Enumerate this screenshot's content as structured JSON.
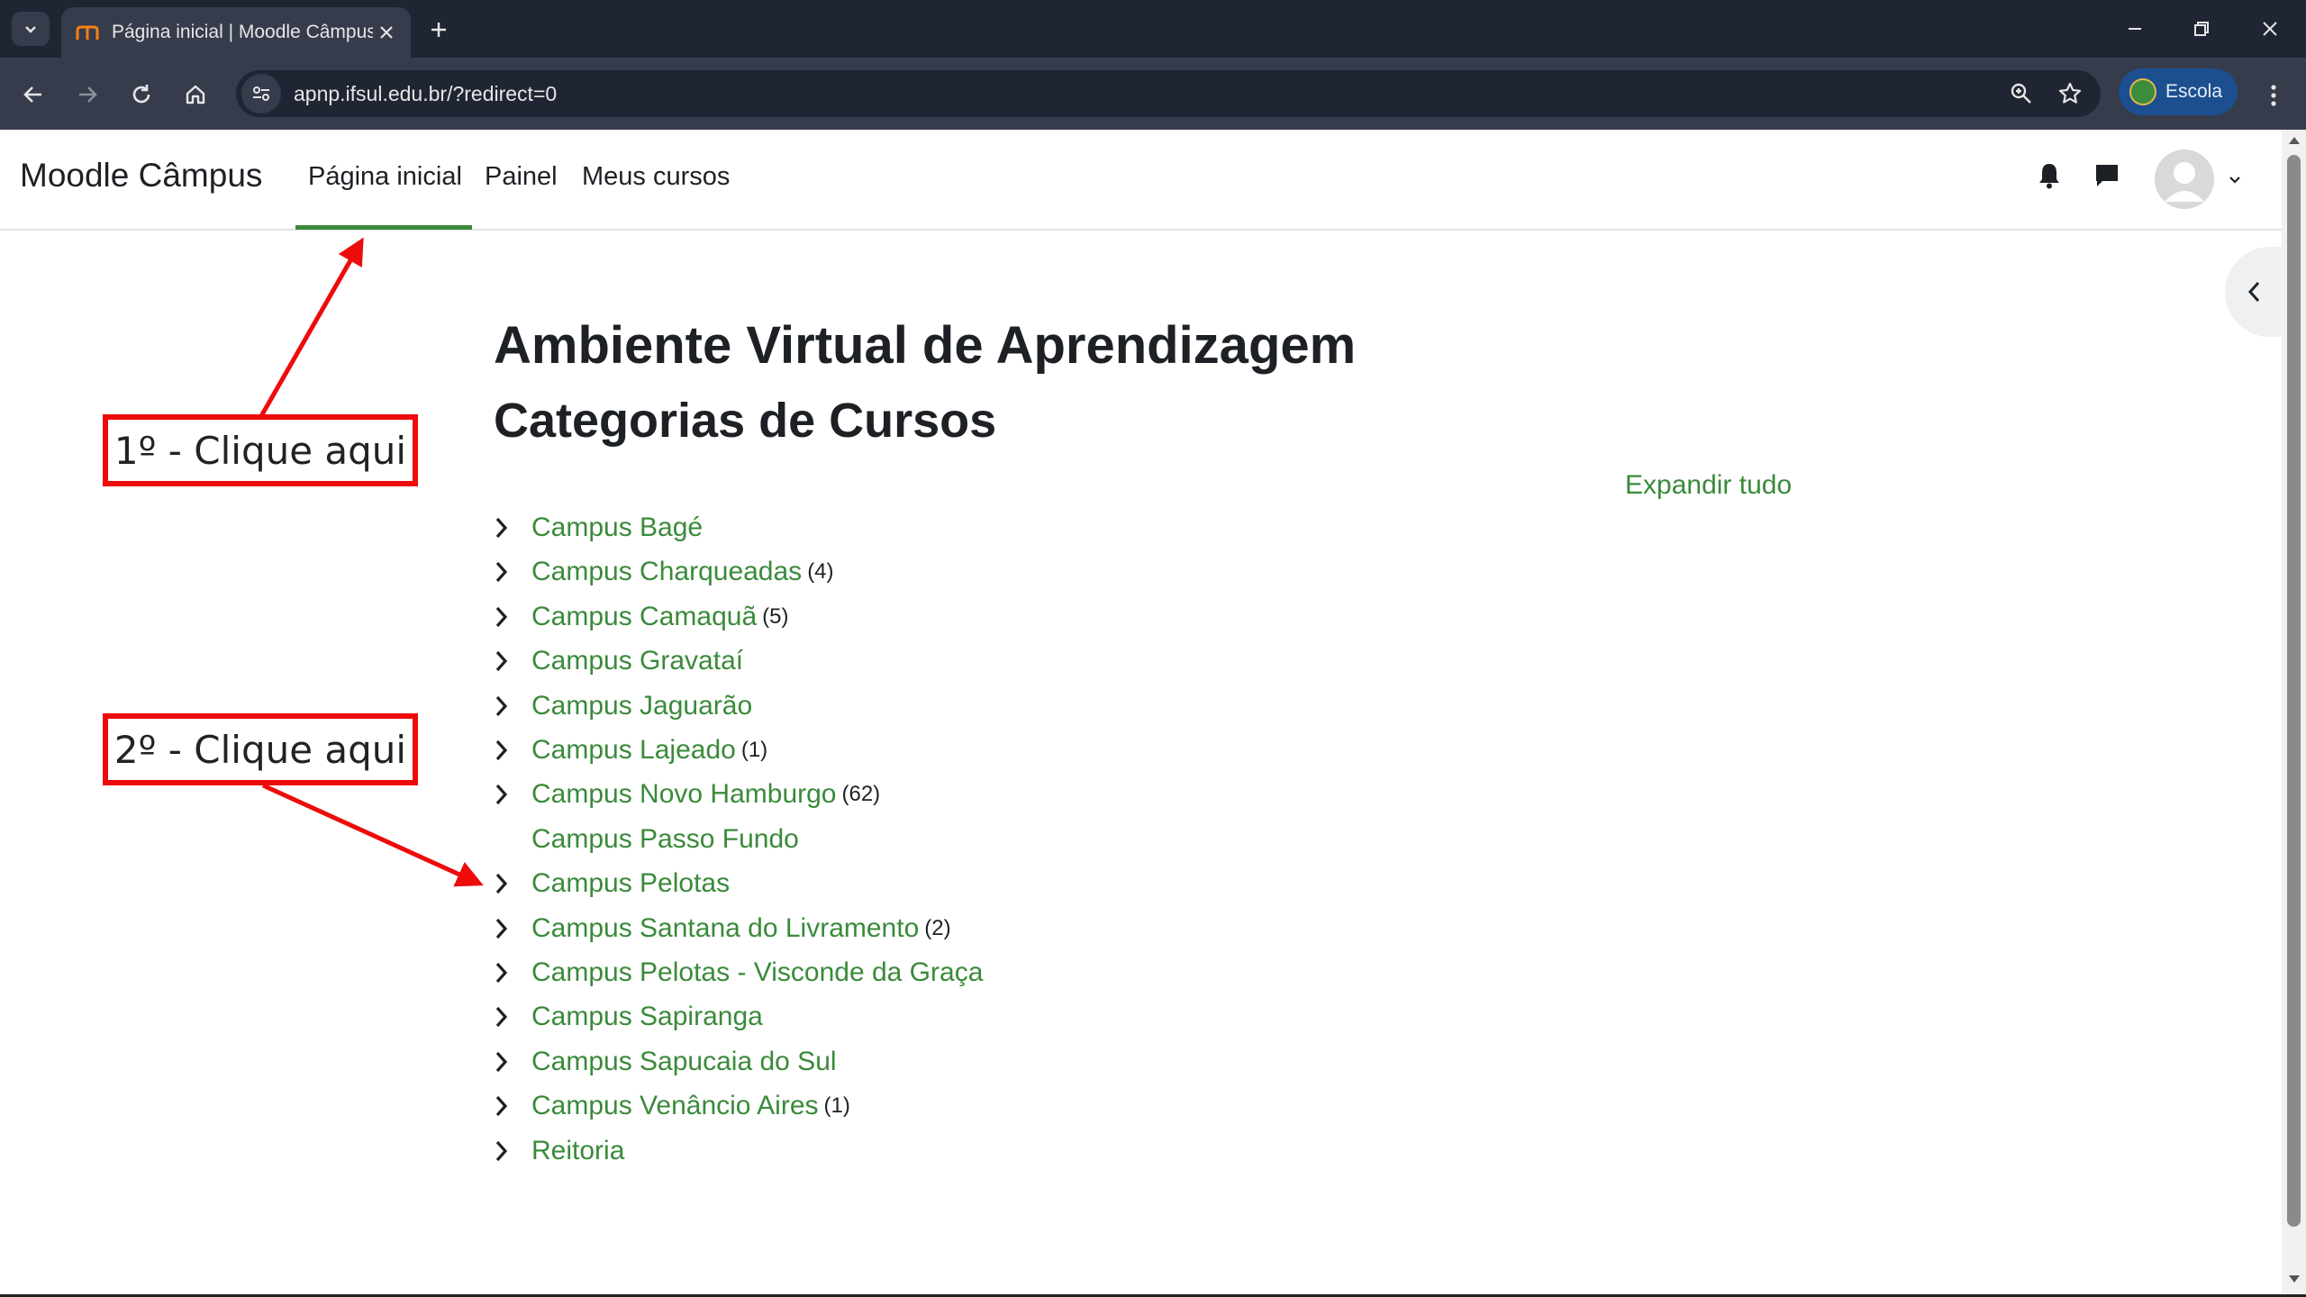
{
  "browser": {
    "tab_title": "Página inicial | Moodle Câmpus",
    "url": "apnp.ifsul.edu.br/?redirect=0",
    "profile_label": "Escola"
  },
  "site": {
    "brand": "Moodle Câmpus",
    "nav": [
      "Página inicial",
      "Painel",
      "Meus cursos"
    ]
  },
  "main": {
    "heading": "Ambiente Virtual de Aprendizagem",
    "subheading": "Categorias de Cursos",
    "expand_all": "Expandir tudo",
    "categories": [
      {
        "name": "Campus Bagé",
        "count": "",
        "expandable": true
      },
      {
        "name": "Campus Charqueadas",
        "count": "(4)",
        "expandable": true
      },
      {
        "name": "Campus Camaquã",
        "count": "(5)",
        "expandable": true
      },
      {
        "name": "Campus Gravataí",
        "count": "",
        "expandable": true
      },
      {
        "name": "Campus Jaguarão",
        "count": "",
        "expandable": true
      },
      {
        "name": "Campus Lajeado",
        "count": "(1)",
        "expandable": true
      },
      {
        "name": "Campus Novo Hamburgo",
        "count": "(62)",
        "expandable": true
      },
      {
        "name": "Campus Passo Fundo",
        "count": "",
        "expandable": false
      },
      {
        "name": "Campus Pelotas",
        "count": "",
        "expandable": true
      },
      {
        "name": "Campus Santana do Livramento",
        "count": "(2)",
        "expandable": true
      },
      {
        "name": "Campus Pelotas - Visconde da Graça",
        "count": "",
        "expandable": true
      },
      {
        "name": "Campus Sapiranga",
        "count": "",
        "expandable": true
      },
      {
        "name": "Campus Sapucaia do Sul",
        "count": "",
        "expandable": true
      },
      {
        "name": "Campus Venâncio Aires",
        "count": "(1)",
        "expandable": true
      },
      {
        "name": "Reitoria",
        "count": "",
        "expandable": true
      }
    ]
  },
  "annotations": {
    "step1": "1º - Clique aqui",
    "step2": "2º - Clique aqui"
  },
  "colors": {
    "link_green": "#3a8a3a",
    "annotation_red": "#ee0b0b",
    "chrome_dark": "#1f2533",
    "chrome_toolbar": "#363c4b"
  }
}
